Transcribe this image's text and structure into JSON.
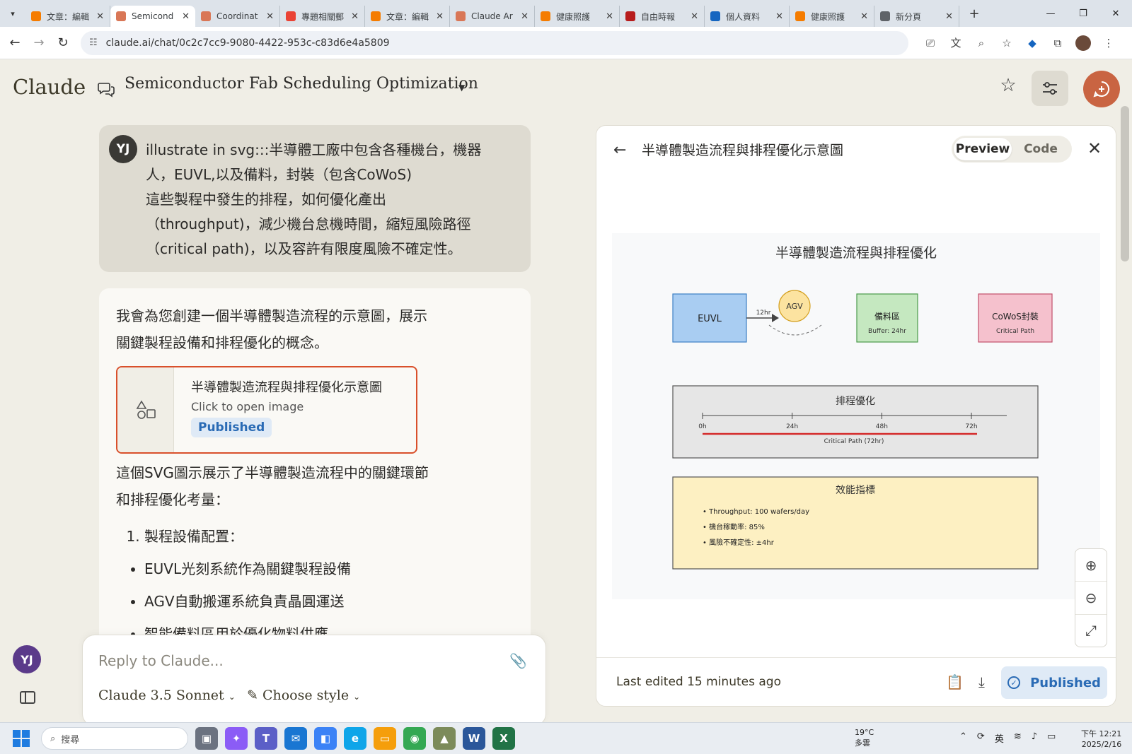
{
  "browser": {
    "tabs": [
      {
        "label": "文章：編輯",
        "favicon_color": "#f57c00",
        "active": false
      },
      {
        "label": "Semicond",
        "favicon_color": "#d97757",
        "active": true
      },
      {
        "label": "Coordinat",
        "favicon_color": "#d97757",
        "active": false
      },
      {
        "label": "專題相關郵",
        "favicon_color": "#ea4335",
        "active": false
      },
      {
        "label": "文章：編輯",
        "favicon_color": "#f57c00",
        "active": false
      },
      {
        "label": "Claude Ar",
        "favicon_color": "#d97757",
        "active": false
      },
      {
        "label": "健康照護",
        "favicon_color": "#f57c00",
        "active": false
      },
      {
        "label": "自由時報",
        "favicon_color": "#b71c1c",
        "active": false
      },
      {
        "label": "個人資料",
        "favicon_color": "#1565c0",
        "active": false
      },
      {
        "label": "健康照護",
        "favicon_color": "#f57c00",
        "active": false
      },
      {
        "label": "新分頁",
        "favicon_color": "#5f6368",
        "active": false
      }
    ],
    "url": "claude.ai/chat/0c2c7cc9-9080-4422-953c-c83d6e4a5809"
  },
  "header": {
    "logo": "Claude",
    "chat_title": "Semiconductor Fab Scheduling Optimization",
    "accent_color": "#c96442"
  },
  "user_message": {
    "avatar": "YJ",
    "line1": "illustrate in svg:::半導體工廠中包含各種機台，機器",
    "line2": "人，EUVL,以及備料，封裝（包含CoWoS)",
    "line3": "這些製程中發生的排程，如何優化產出",
    "line4": "（throughput)，減少機台怠機時間，縮短風險路徑",
    "line5": "（critical path)，以及容許有限度風險不確定性。"
  },
  "assistant": {
    "intro_line1": "我會為您創建一個半導體製造流程的示意圖，展示",
    "intro_line2": "關鍵製程設備和排程優化的概念。",
    "artifact": {
      "title": "半導體製造流程與排程優化示意圖",
      "subtitle": "Click to open image",
      "badge": "Published"
    },
    "para2_line1": "這個SVG圖示展示了半導體製造流程中的關鍵環節",
    "para2_line2": "和排程優化考量：",
    "list_item1": "製程設備配置：",
    "bullet1": "EUVL光刻系統作為關鍵製程設備",
    "bullet2": "AGV自動搬運系統負責晶圓運送",
    "bullet3": "智能備料區用於優化物料供應"
  },
  "reply": {
    "placeholder": "Reply to Claude...",
    "model": "Claude 3.5 Sonnet",
    "style": "Choose style"
  },
  "sidebar": {
    "avatar": "YJ"
  },
  "panel": {
    "title": "半導體製造流程與排程優化示意圖",
    "tab_preview": "Preview",
    "tab_code": "Code",
    "last_edited": "Last edited 15 minutes ago",
    "published": "Published"
  },
  "diagram": {
    "title": "半導體製造流程與排程優化",
    "euvl": "EUVL",
    "arrow_label": "12hr",
    "agv": "AGV",
    "buffer_title": "備料區",
    "buffer_sub": "Buffer: 24hr",
    "cowos_title": "CoWoS封裝",
    "cowos_sub": "Critical Path",
    "schedule_title": "排程優化",
    "ticks": [
      "0h",
      "24h",
      "48h",
      "72h"
    ],
    "critical_label": "Critical Path (72hr)",
    "metrics_title": "效能指標",
    "metric1": "• Throughput: 100 wafers/day",
    "metric2": "• 機台稼動率: 85%",
    "metric3": "• 風險不確定性: ±4hr"
  },
  "taskbar": {
    "search_placeholder": "搜尋",
    "weather_temp": "19°C",
    "weather_desc": "多雲",
    "ime": "英",
    "time": "下午 12:21",
    "date": "2025/2/16"
  }
}
